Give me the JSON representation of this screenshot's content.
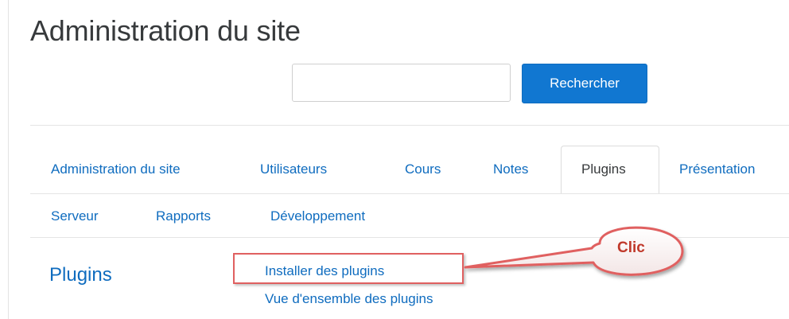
{
  "page": {
    "title": "Administration du site"
  },
  "search": {
    "value": "",
    "button_label": "Rechercher"
  },
  "tabs": [
    {
      "label": "Administration du site",
      "active": false
    },
    {
      "label": "Utilisateurs",
      "active": false
    },
    {
      "label": "Cours",
      "active": false
    },
    {
      "label": "Notes",
      "active": false
    },
    {
      "label": "Plugins",
      "active": true
    },
    {
      "label": "Présentation",
      "active": false
    },
    {
      "label": "Serveur",
      "active": false
    },
    {
      "label": "Rapports",
      "active": false
    },
    {
      "label": "Développement",
      "active": false
    }
  ],
  "section": {
    "heading": "Plugins",
    "links": [
      {
        "label": "Installer des plugins"
      },
      {
        "label": "Vue d'ensemble des plugins"
      }
    ]
  },
  "annotation": {
    "callout_text": "Clic"
  },
  "colors": {
    "link": "#0f6cbf",
    "button": "#1177d1",
    "annotation_red": "#e06060"
  }
}
